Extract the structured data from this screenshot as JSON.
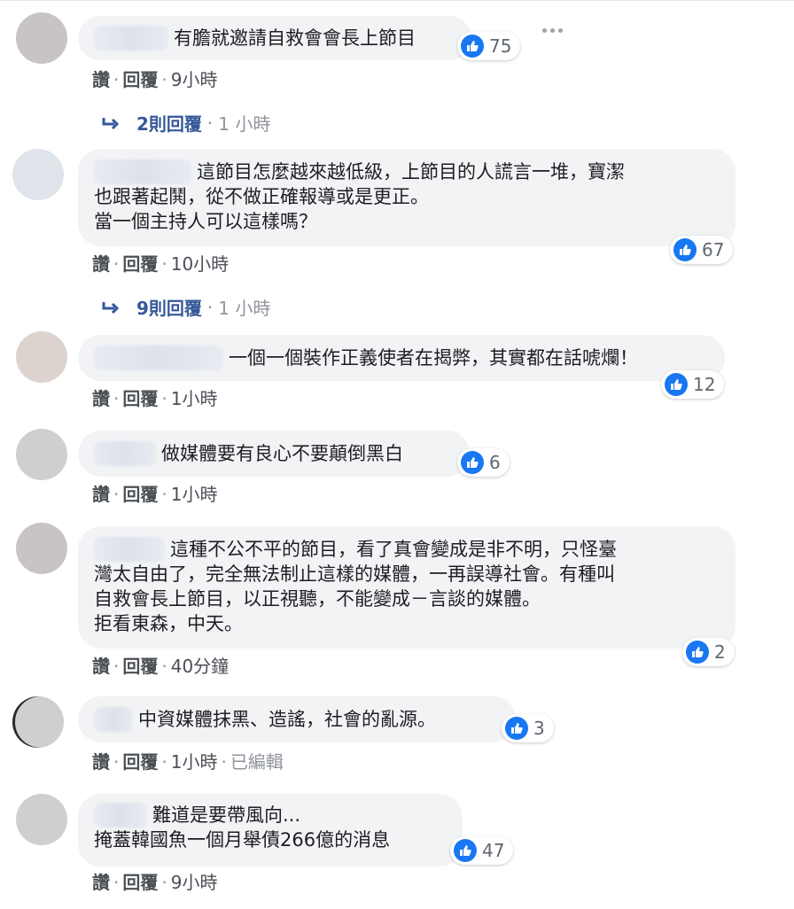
{
  "labels": {
    "like": "讚",
    "reply": "回覆",
    "separator": "·",
    "edited": "已編輯"
  },
  "colors": {
    "like_blue": "#1877f2",
    "bubble_bg": "#f2f3f5",
    "link_blue": "#365899"
  },
  "comments": [
    {
      "text": "有膽就邀請自救會會長上節目",
      "likes": "75",
      "time": "9小時",
      "replies": {
        "label": "2則回覆",
        "time": "1 小時"
      }
    },
    {
      "text": "這節目怎麼越來越低級，上節目的人謊言一堆，寶潔\n也跟著起鬨，從不做正確報導或是更正。\n當一個主持人可以這樣嗎？",
      "likes": "67",
      "time": "10小時",
      "replies": {
        "label": "9則回覆",
        "time": "1 小時"
      }
    },
    {
      "text": "一個一個裝作正義使者在揭弊，其實都在話唬爛！",
      "likes": "12",
      "time": "1小時"
    },
    {
      "text": "做媒體要有良心不要顛倒黑白",
      "likes": "6",
      "time": "1小時"
    },
    {
      "text": "這種不公不平的節目，看了真會變成是非不明，只怪臺\n灣太自由了，完全無法制止這樣的媒體，一再誤導社會。有種叫\n自救會長上節目，以正視聽，不能變成－言談的媒體。\n拒看東森，中天。",
      "likes": "2",
      "time": "40分鐘"
    },
    {
      "text": "中資媒體抹黑、造謠，社會的亂源。",
      "likes": "3",
      "time": "1小時"
    },
    {
      "text": "難道是要帶風向...\n掩蓋韓國魚一個月舉債266億的消息",
      "likes": "47",
      "time": "9小時"
    }
  ]
}
